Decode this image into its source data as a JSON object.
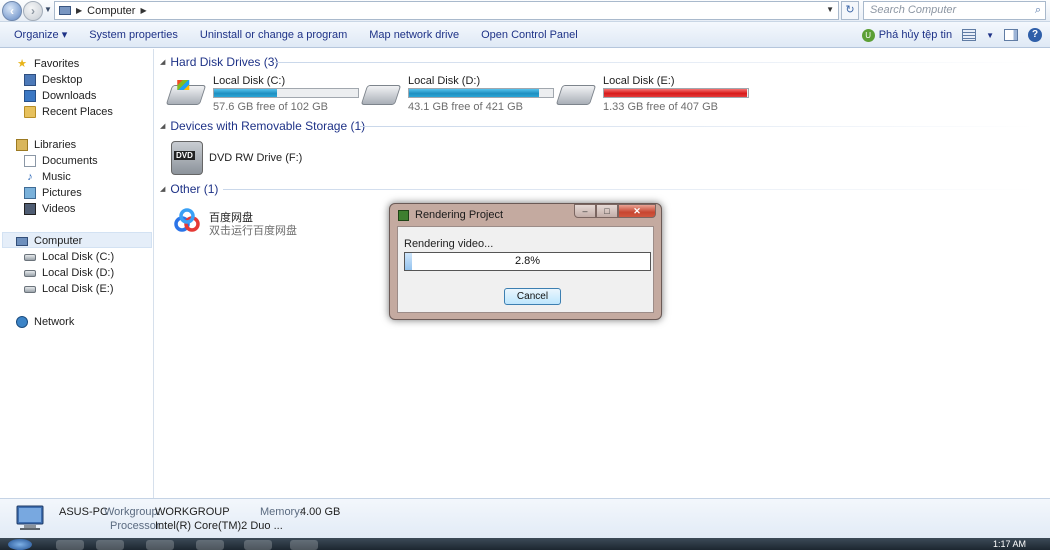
{
  "addressbar": {
    "path": "Computer",
    "search_placeholder": "Search Computer"
  },
  "toolbar": {
    "organize": "Organize ▾",
    "system_properties": "System properties",
    "uninstall": "Uninstall or change a program",
    "map_drive": "Map network drive",
    "control_panel": "Open Control Panel",
    "extra": "Phá hủy tệp tin"
  },
  "sidebar": {
    "favorites": "Favorites",
    "desktop": "Desktop",
    "downloads": "Downloads",
    "recent": "Recent Places",
    "libraries": "Libraries",
    "documents": "Documents",
    "music": "Music",
    "pictures": "Pictures",
    "videos": "Videos",
    "computer": "Computer",
    "disk_c": "Local Disk (C:)",
    "disk_d": "Local Disk (D:)",
    "disk_e": "Local Disk (E:)",
    "network": "Network"
  },
  "groups": {
    "hdd": "Hard Disk Drives (3)",
    "removable": "Devices with Removable Storage (1)",
    "other": "Other (1)"
  },
  "drives": [
    {
      "name": "Local Disk (C:)",
      "free": "57.6 GB free of 102 GB",
      "used_fraction": 0.44
    },
    {
      "name": "Local Disk (D:)",
      "free": "43.1 GB free of 421 GB",
      "used_fraction": 0.9
    },
    {
      "name": "Local Disk (E:)",
      "free": "1.33 GB free of 407 GB",
      "used_fraction": 0.99
    }
  ],
  "dvd": {
    "name": "DVD RW Drive (F:)",
    "label": "DVD"
  },
  "baidu": {
    "name": "百度网盘",
    "desc": "双击运行百度网盘"
  },
  "dialog": {
    "title": "Rendering Project",
    "status": "Rendering video...",
    "progress_text": "2.8%",
    "progress_value": 0.028,
    "cancel": "Cancel"
  },
  "details": {
    "pc_name": "ASUS-PC",
    "workgroup_label": "Workgroup:",
    "workgroup": "WORKGROUP",
    "memory_label": "Memory:",
    "memory": "4.00 GB",
    "processor_label": "Processor:",
    "processor": "Intel(R) Core(TM)2 Duo ..."
  },
  "taskbar": {
    "clock": "1:17 AM"
  },
  "colors": {
    "bar_blue": "#1f8fc0",
    "bar_red": "#d71a1a",
    "link_blue": "#1e3287"
  }
}
